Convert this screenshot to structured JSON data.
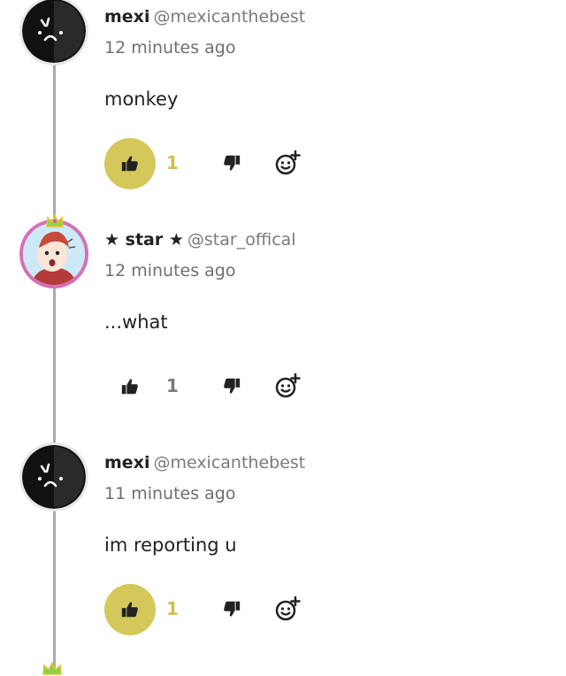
{
  "comments": [
    {
      "name": "mexi",
      "handle": "@mexicanthebest",
      "time": "12 minutes ago",
      "body": "monkey",
      "likes": "1",
      "liked": true,
      "avatar": "black-ball-avatar"
    },
    {
      "name": "★ star ★",
      "handle": "@star_offical",
      "time": "12 minutes ago",
      "body": "...what",
      "likes": "1",
      "liked": false,
      "avatar": "cartoon-character-avatar"
    },
    {
      "name": "mexi",
      "handle": "@mexicanthebest",
      "time": "11 minutes ago",
      "body": "im reporting u",
      "likes": "1",
      "liked": true,
      "avatar": "black-ball-avatar"
    }
  ],
  "colors": {
    "like_active_bg": "#d4c85a",
    "like_active_count": "#d0bf4a",
    "thread_line": "#a9a9a9"
  },
  "icons": {
    "like": "thumbs-up-icon",
    "dislike": "thumbs-down-icon",
    "react": "add-reaction-icon"
  }
}
